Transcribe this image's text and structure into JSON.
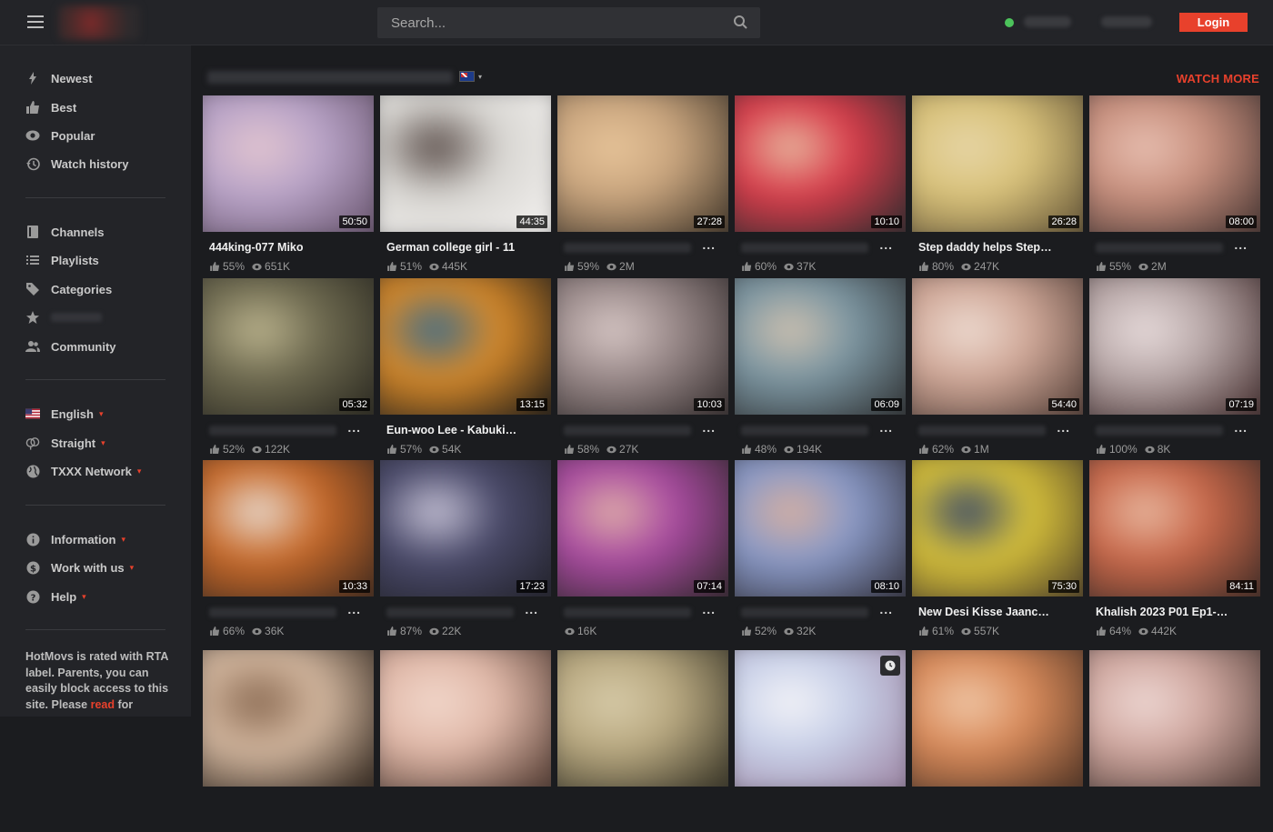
{
  "search": {
    "placeholder": "Search..."
  },
  "header": {
    "login_label": "Login"
  },
  "sidebar": {
    "main_nav": [
      {
        "label": "Newest",
        "icon": "lightning-icon"
      },
      {
        "label": "Best",
        "icon": "thumbs-up-icon"
      },
      {
        "label": "Popular",
        "icon": "eye-icon"
      },
      {
        "label": "Watch history",
        "icon": "history-icon"
      }
    ],
    "browse_nav": [
      {
        "label": "Channels",
        "icon": "channels-icon"
      },
      {
        "label": "Playlists",
        "icon": "list-icon"
      },
      {
        "label": "Categories",
        "icon": "tag-icon"
      },
      {
        "label": "",
        "icon": "star-icon"
      },
      {
        "label": "Community",
        "icon": "people-icon"
      }
    ],
    "settings_nav": [
      {
        "label": "English",
        "icon": "us-flag-icon"
      },
      {
        "label": "Straight",
        "icon": "gender-icon"
      },
      {
        "label": "TXXX Network",
        "icon": "globe-icon"
      }
    ],
    "info_nav": [
      {
        "label": "Information",
        "icon": "info-icon"
      },
      {
        "label": "Work with us",
        "icon": "dollar-icon"
      },
      {
        "label": "Help",
        "icon": "help-icon"
      }
    ],
    "note_text": "HotMovs is rated with RTA label. Parents, you can easily block access to this site. Please ",
    "note_link": "read",
    "note_tail": " for"
  },
  "main": {
    "watch_more": "WATCH MORE",
    "videos": [
      {
        "title": "444king-077 Miko",
        "duration": "50:50",
        "rating": "55%",
        "views": "651K",
        "c1": "#b9a4c8",
        "c2": "#e3c6d0",
        "c3": "#6e5a74"
      },
      {
        "title": "German college girl - 11",
        "duration": "44:35",
        "rating": "51%",
        "views": "445K",
        "c1": "#d8d6d2",
        "c2": "#5b4e4a",
        "c3": "#f2f0ee"
      },
      {
        "title": "",
        "duration": "27:28",
        "rating": "59%",
        "views": "2M",
        "c1": "#c9a57e",
        "c2": "#e8c59a",
        "c3": "#4a3d2e"
      },
      {
        "title": "",
        "duration": "10:10",
        "rating": "60%",
        "views": "37K",
        "c1": "#d83c4a",
        "c2": "#e8b9a0",
        "c3": "#3a2d30"
      },
      {
        "title": "Step daddy helps Step da...",
        "duration": "26:28",
        "rating": "80%",
        "views": "247K",
        "c1": "#d9c27a",
        "c2": "#e7d6a8",
        "c3": "#6a5a3a"
      },
      {
        "title": "",
        "duration": "08:00",
        "rating": "55%",
        "views": "2M",
        "c1": "#c8907e",
        "c2": "#e8c0b2",
        "c3": "#4e3a36"
      },
      {
        "title": "",
        "duration": "05:32",
        "rating": "52%",
        "views": "122K",
        "c1": "#6e6a50",
        "c2": "#bcb48e",
        "c3": "#2e2c22"
      },
      {
        "title": "Eun-woo Lee - Kabukicho...",
        "duration": "13:15",
        "rating": "57%",
        "views": "54K",
        "c1": "#d88a2a",
        "c2": "#3f6d8a",
        "c3": "#2a2218"
      },
      {
        "title": "",
        "duration": "10:03",
        "rating": "58%",
        "views": "27K",
        "c1": "#9a8a8a",
        "c2": "#d8c8c6",
        "c3": "#3a3232"
      },
      {
        "title": "",
        "duration": "06:09",
        "rating": "48%",
        "views": "194K",
        "c1": "#7c96a2",
        "c2": "#d0c2b0",
        "c3": "#34383a"
      },
      {
        "title": "",
        "duration": "54:40",
        "rating": "62%",
        "views": "1M",
        "c1": "#d0a898",
        "c2": "#eedcd2",
        "c3": "#5a443c"
      },
      {
        "title": "",
        "duration": "07:19",
        "rating": "100%",
        "views": "8K",
        "c1": "#b8a8a8",
        "c2": "#e8dcdc",
        "c3": "#4a3434"
      },
      {
        "title": "",
        "duration": "10:33",
        "rating": "66%",
        "views": "36K",
        "c1": "#c86a2a",
        "c2": "#e8dcd2",
        "c3": "#4a2e1e"
      },
      {
        "title": "",
        "duration": "17:23",
        "rating": "87%",
        "views": "22K",
        "c1": "#4a4a6a",
        "c2": "#c8c4d8",
        "c3": "#24242e"
      },
      {
        "title": "",
        "duration": "07:14",
        "rating": "",
        "views": "16K",
        "c1": "#a84aa0",
        "c2": "#e0b0a8",
        "c3": "#3a2a34"
      },
      {
        "title": "",
        "duration": "08:10",
        "rating": "52%",
        "views": "32K",
        "c1": "#8a9ac8",
        "c2": "#d8b0a0",
        "c3": "#3a3a48"
      },
      {
        "title": "New Desi Kisse Jaanch P...",
        "duration": "75:30",
        "rating": "61%",
        "views": "557K",
        "c1": "#d8c23a",
        "c2": "#3a4a6a",
        "c3": "#5a4a2a"
      },
      {
        "title": "Khalish 2023 P01 Ep1-3 Ul...",
        "duration": "84:11",
        "rating": "64%",
        "views": "442K",
        "c1": "#c8684a",
        "c2": "#e8b8a0",
        "c3": "#4a3028"
      },
      {
        "title": "",
        "duration": "",
        "rating": "",
        "views": "",
        "c1": "#d4b8a0",
        "c2": "#8a6a52",
        "c3": "#3a2e24"
      },
      {
        "title": "",
        "duration": "",
        "rating": "",
        "views": "",
        "c1": "#e0b8a8",
        "c2": "#f2d8cc",
        "c3": "#5a4238"
      },
      {
        "title": "",
        "duration": "",
        "rating": "",
        "views": "",
        "c1": "#b8a880",
        "c2": "#d8ccaa",
        "c3": "#3e3a2a"
      },
      {
        "title": "",
        "duration": "",
        "rating": "",
        "views": "",
        "c1": "#c8d0e8",
        "c2": "#f4f4f8",
        "c3": "#a08aa8"
      },
      {
        "title": "",
        "duration": "",
        "rating": "",
        "views": "",
        "c1": "#d88a5a",
        "c2": "#f0c8a8",
        "c3": "#5a3a28"
      },
      {
        "title": "",
        "duration": "",
        "rating": "",
        "views": "",
        "c1": "#d0a8a0",
        "c2": "#eed8d4",
        "c3": "#5a443e"
      }
    ]
  },
  "colors": {
    "accent": "#e8412c",
    "online": "#4cc35b"
  }
}
